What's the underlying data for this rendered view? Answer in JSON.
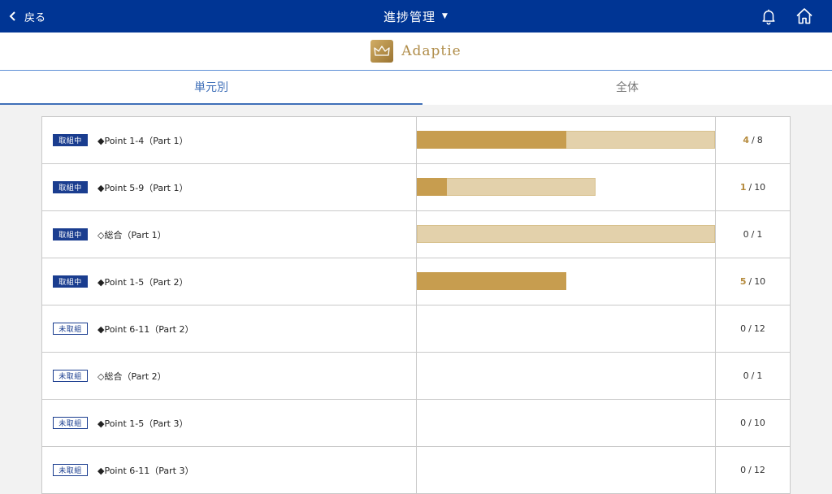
{
  "header": {
    "back_label": "戻る",
    "title": "進捗管理",
    "title_caret": "▼"
  },
  "brand": {
    "name": "Adaptie"
  },
  "tabs": [
    {
      "label": "単元別",
      "active": true
    },
    {
      "label": "全体",
      "active": false
    }
  ],
  "colors": {
    "header_bg": "#003594",
    "accent_gold": "#c79d4f",
    "bar_light": "#e3d1ab",
    "badge_navy": "#1a3d8f",
    "tab_active": "#3f6fb8"
  },
  "rows": [
    {
      "status": "取組中",
      "status_type": "active",
      "name": "◆Point 1-4（Part 1）",
      "bar_total": 1.0,
      "bar_done": 0.5,
      "done": "4",
      "total": "8"
    },
    {
      "status": "取組中",
      "status_type": "active",
      "name": "◆Point 5-9（Part 1）",
      "bar_total": 0.6,
      "bar_done": 0.1,
      "done": "1",
      "total": "10"
    },
    {
      "status": "取組中",
      "status_type": "active",
      "name": "◇総合（Part 1）",
      "bar_total": 1.0,
      "bar_done": 0.0,
      "done": "0",
      "total": "1"
    },
    {
      "status": "取組中",
      "status_type": "active",
      "name": "◆Point 1-5（Part 2）",
      "bar_total": 0.5,
      "bar_done": 0.5,
      "done": "5",
      "total": "10"
    },
    {
      "status": "未取組",
      "status_type": "todo",
      "name": "◆Point 6-11（Part 2）",
      "bar_total": 0,
      "bar_done": 0,
      "done": "0",
      "total": "12"
    },
    {
      "status": "未取組",
      "status_type": "todo",
      "name": "◇総合（Part 2）",
      "bar_total": 0,
      "bar_done": 0,
      "done": "0",
      "total": "1"
    },
    {
      "status": "未取組",
      "status_type": "todo",
      "name": "◆Point 1-5（Part 3）",
      "bar_total": 0,
      "bar_done": 0,
      "done": "0",
      "total": "10"
    },
    {
      "status": "未取組",
      "status_type": "todo",
      "name": "◆Point 6-11（Part 3）",
      "bar_total": 0,
      "bar_done": 0,
      "done": "0",
      "total": "12"
    }
  ]
}
